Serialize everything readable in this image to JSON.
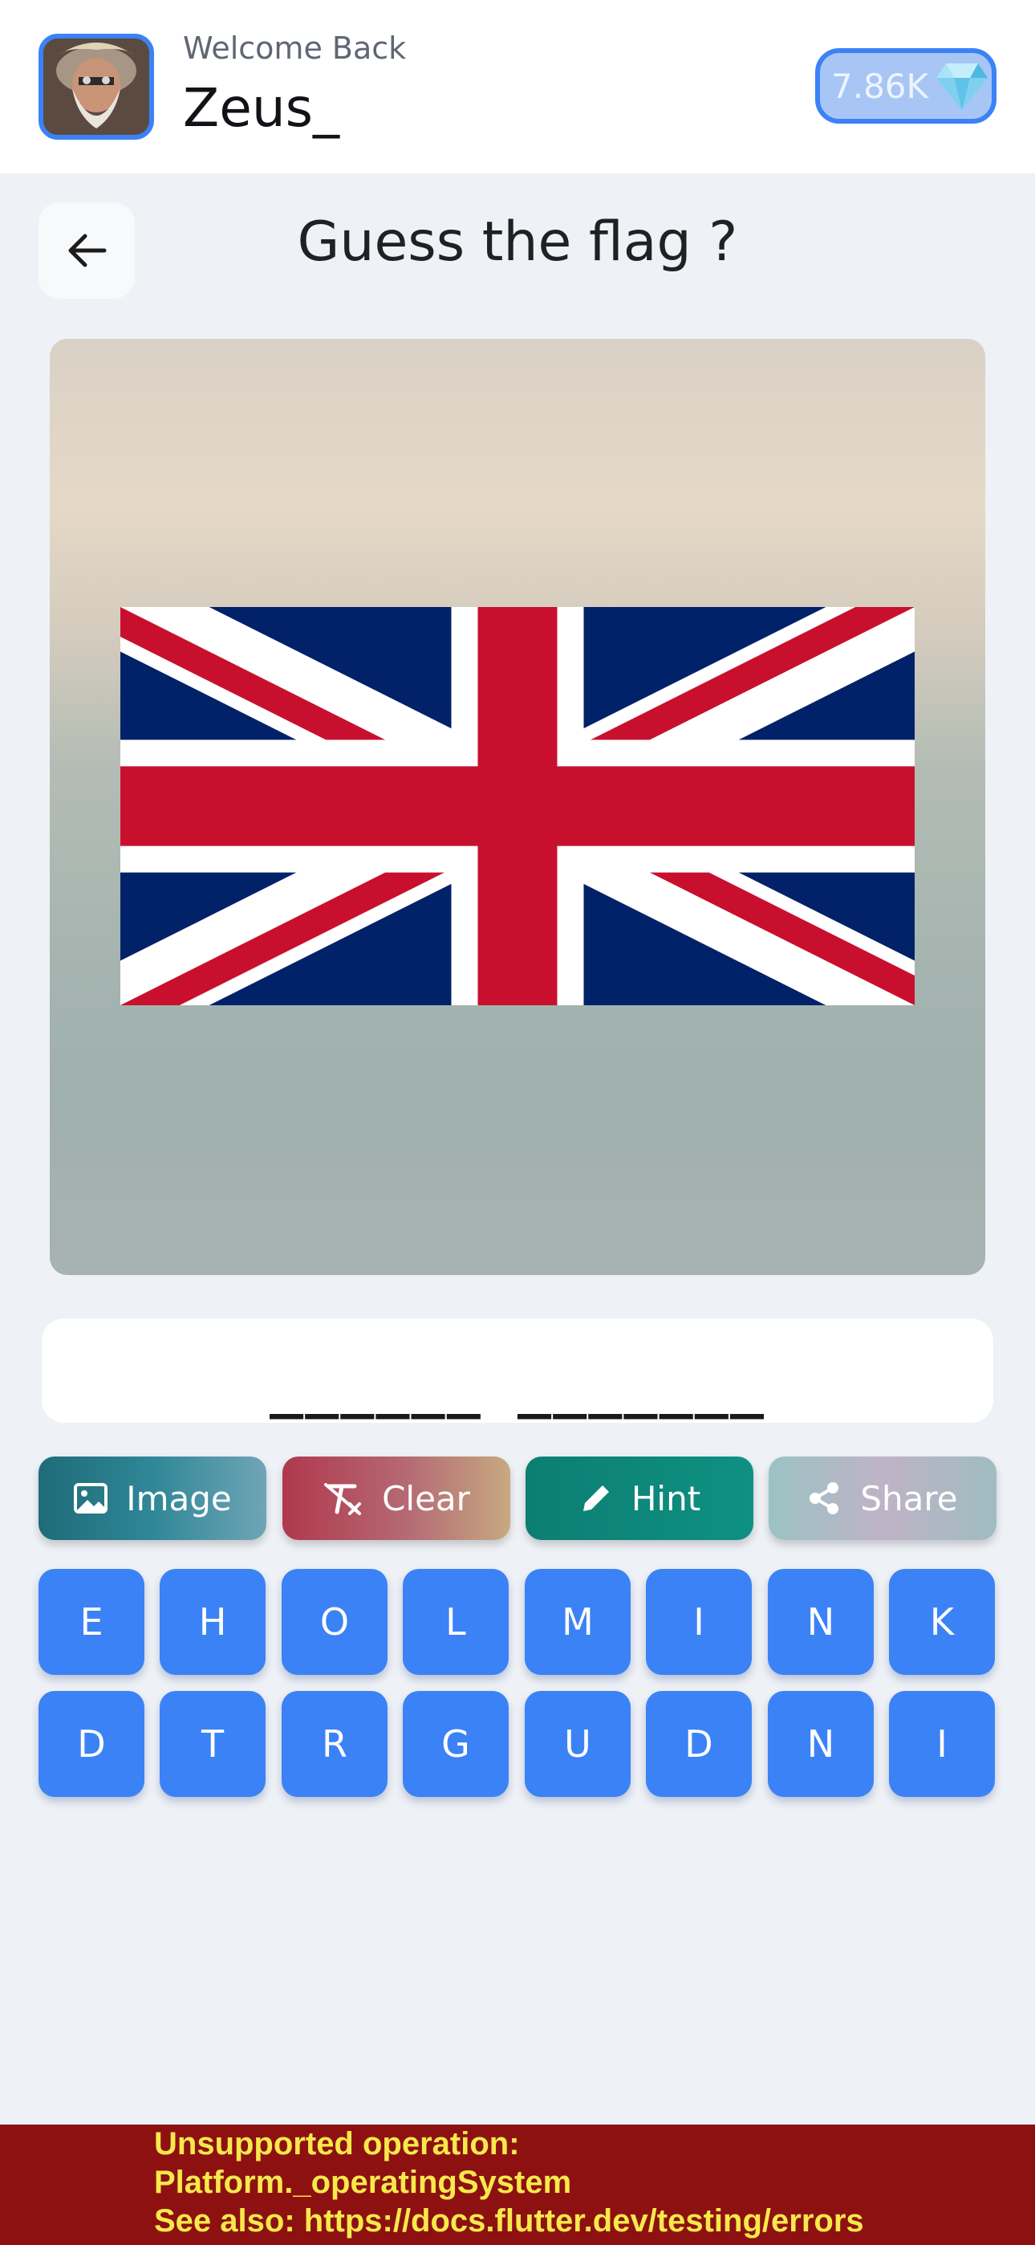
{
  "header": {
    "welcome": "Welcome Back",
    "username": "Zeus_",
    "gems": "7.86K",
    "gem_icon": "diamond-icon",
    "avatar_icon": "avatar"
  },
  "page": {
    "back_icon": "arrow-left-icon",
    "title": "Guess the flag ?"
  },
  "question_image": {
    "flag_icon": "union-jack-flag"
  },
  "answer": {
    "blanks": "______ _______"
  },
  "actions": [
    {
      "label": "Image",
      "icon": "image-icon",
      "color": "#1f6b79"
    },
    {
      "label": "Clear",
      "icon": "clear-format-icon",
      "color": "#b0384d"
    },
    {
      "label": "Hint",
      "icon": "pencil-icon",
      "color": "#0c7e72"
    },
    {
      "label": "Share",
      "icon": "share-icon",
      "color": "#9bc3c4"
    }
  ],
  "letters": {
    "row1": [
      "E",
      "H",
      "O",
      "L",
      "M",
      "I",
      "N",
      "K"
    ],
    "row2": [
      "D",
      "T",
      "R",
      "G",
      "U",
      "D",
      "N",
      "I"
    ]
  },
  "error": {
    "line1": "Unsupported operation:",
    "line2": "Platform._operatingSystem",
    "line3": "See also: https://docs.flutter.dev/testing/errors"
  },
  "colors": {
    "accent": "#3b82f6",
    "error_bg": "#8e1111",
    "error_text": "#f6e94a"
  }
}
